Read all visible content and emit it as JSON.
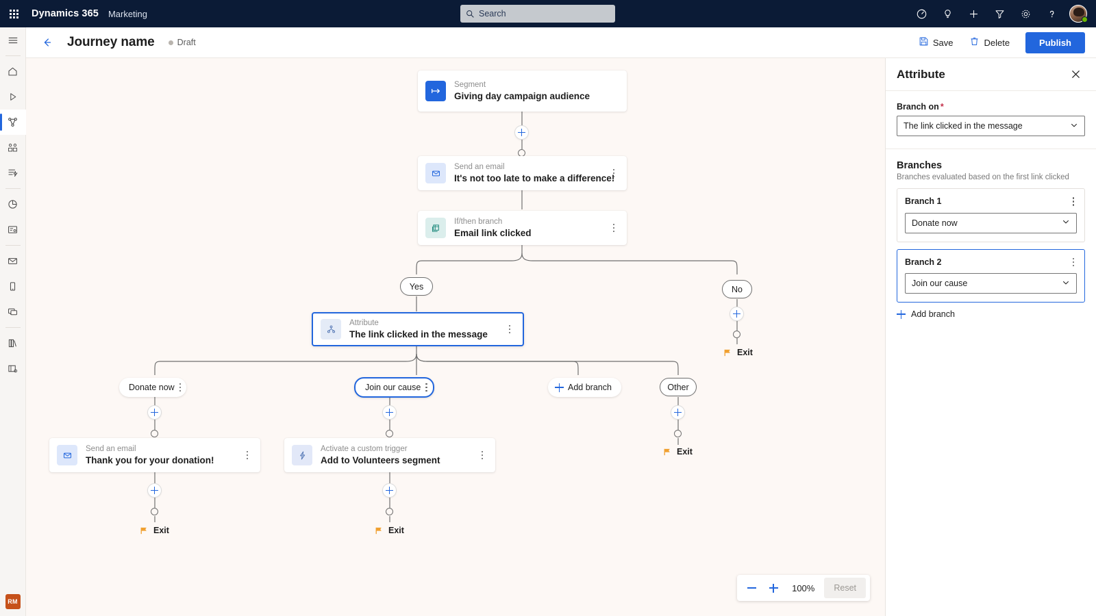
{
  "topbar": {
    "waffle_label": "app-launcher",
    "brand": "Dynamics 365",
    "app": "Marketing",
    "search_placeholder": "Search",
    "icons": [
      "insights-icon",
      "lightbulb-icon",
      "plus-icon",
      "filter-icon",
      "gear-icon",
      "help-icon"
    ]
  },
  "rail": {
    "items": [
      {
        "icon": "hamburger-icon",
        "name": "menu"
      },
      {
        "icon": "home-icon",
        "name": "home"
      },
      {
        "icon": "play-icon",
        "name": "recent"
      },
      {
        "icon": "journeys-icon",
        "name": "journeys",
        "active": true
      },
      {
        "icon": "segments-icon",
        "name": "segments"
      },
      {
        "icon": "triggers-icon",
        "name": "triggers"
      },
      {
        "icon": "analytics-icon",
        "name": "analytics"
      },
      {
        "icon": "forms-icon",
        "name": "forms"
      },
      {
        "icon": "email-icon",
        "name": "emails"
      },
      {
        "icon": "mobile-icon",
        "name": "text-messages"
      },
      {
        "icon": "push-icon",
        "name": "push-notifications"
      },
      {
        "icon": "library-icon",
        "name": "library"
      },
      {
        "icon": "assets-icon",
        "name": "assets"
      }
    ],
    "user_initials": "RM"
  },
  "commandbar": {
    "back": "back-arrow",
    "title": "Journey name",
    "status": "Draft",
    "save_label": "Save",
    "delete_label": "Delete",
    "publish_label": "Publish"
  },
  "canvas": {
    "nodes": [
      {
        "id": "segment",
        "kind": "Segment",
        "name": "Giving day campaign audience",
        "icon": "segment-icon",
        "more": false,
        "selected": false
      },
      {
        "id": "email1",
        "kind": "Send an email",
        "name": "It's not too late to make a difference!",
        "icon": "email-icon",
        "more": true,
        "selected": false
      },
      {
        "id": "ifthen",
        "kind": "If/then branch",
        "name": "Email link clicked",
        "icon": "branch-icon",
        "more": true,
        "selected": false
      },
      {
        "id": "attribute",
        "kind": "Attribute",
        "name": "The link clicked in the message",
        "icon": "attribute-icon",
        "more": true,
        "selected": true
      },
      {
        "id": "email2",
        "kind": "Send an email",
        "name": "Thank you for your donation!",
        "icon": "email-icon",
        "more": true,
        "selected": false
      },
      {
        "id": "trigger1",
        "kind": "Activate a custom trigger",
        "name": "Add to Volunteers segment",
        "icon": "trigger-icon",
        "more": true,
        "selected": false
      }
    ],
    "branch_labels": {
      "yes": "Yes",
      "no": "No",
      "donate": "Donate now",
      "join": "Join our cause",
      "add_branch": "Add branch",
      "other": "Other"
    },
    "exit_label": "Exit",
    "zoom": {
      "minus": "zoom-out",
      "plus": "zoom-in",
      "level": "100%",
      "reset": "Reset"
    }
  },
  "panel": {
    "title": "Attribute",
    "close": "close-icon",
    "branch_on_label": "Branch on",
    "branch_on_required": "*",
    "branch_on_value": "The link clicked in the message",
    "branches_title": "Branches",
    "branches_desc": "Branches evaluated based on the first link clicked",
    "branches": [
      {
        "name": "Branch 1",
        "value": "Donate now",
        "selected": false
      },
      {
        "name": "Branch 2",
        "value": "Join our cause",
        "selected": true
      }
    ],
    "add_branch_label": "Add branch"
  },
  "colors": {
    "brand_blue": "#2266dd",
    "header_navy": "#0b1b36",
    "canvas_bg": "#fdf8f5",
    "exit_flag": "#f0a030",
    "required_red": "#c4314b",
    "presence_green": "#6bb700"
  }
}
